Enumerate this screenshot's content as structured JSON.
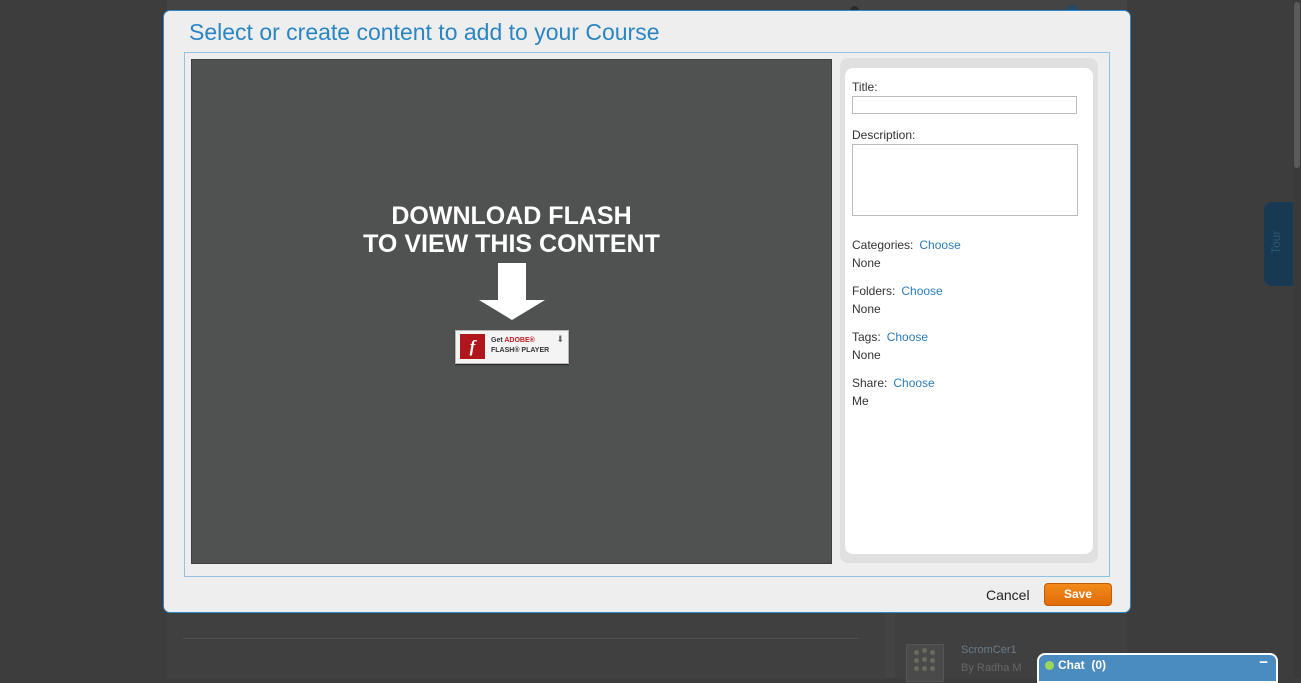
{
  "modal": {
    "title": "Select or create content to add to your Course",
    "flash_message_line1": "DOWNLOAD FLASH",
    "flash_message_line2": "TO VIEW THIS CONTENT",
    "flash_badge": {
      "get": "Get",
      "brand": "ADOBE®",
      "product": "FLASH® PLAYER",
      "icon": "flash-logo-icon"
    }
  },
  "form": {
    "title_label": "Title:",
    "title_value": "",
    "description_label": "Description:",
    "description_value": "",
    "categories_label": "Categories:",
    "categories_link": "Choose",
    "categories_value": "None",
    "folders_label": "Folders:",
    "folders_link": "Choose",
    "folders_value": "None",
    "tags_label": "Tags:",
    "tags_link": "Choose",
    "tags_value": "None",
    "share_label": "Share:",
    "share_link": "Choose",
    "share_value": "Me"
  },
  "actions": {
    "cancel": "Cancel",
    "save": "Save"
  },
  "background": {
    "tour_tab": "Tour",
    "item_title": "ScromCer1",
    "item_byline": "By Radha M"
  },
  "chat": {
    "label": "Chat",
    "count": "(0)",
    "minimize": "−"
  },
  "colors": {
    "accent": "#2a86c2",
    "save": "#e97a10",
    "chat": "#4a8cc0"
  }
}
